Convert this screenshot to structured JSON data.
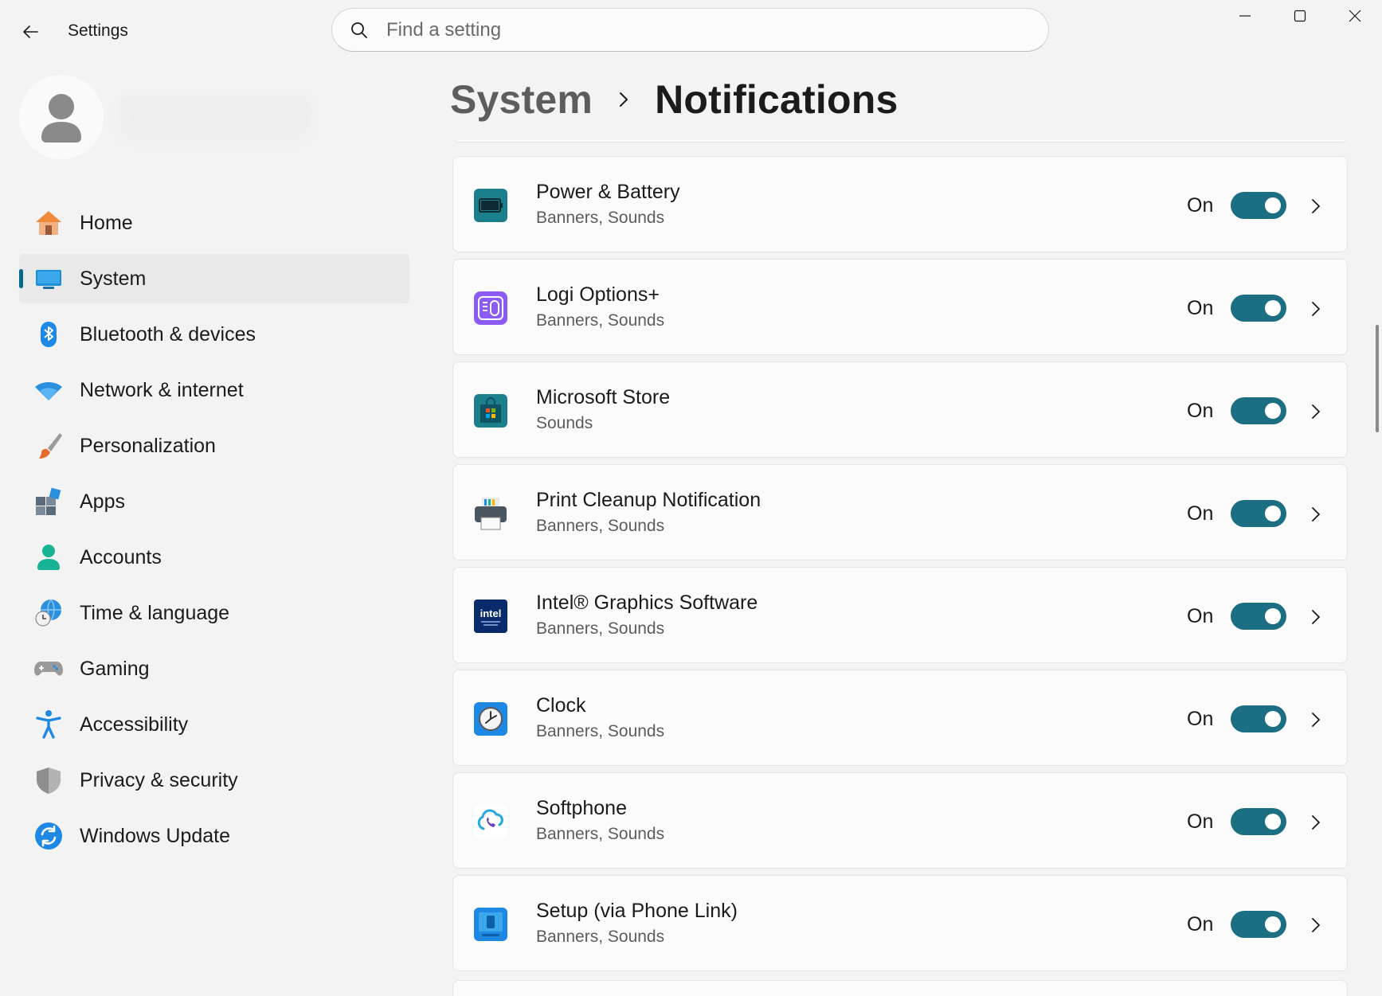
{
  "titlebar": {
    "app_title": "Settings",
    "search_placeholder": "Find a setting"
  },
  "sidebar": {
    "items": [
      {
        "label": "Home",
        "icon": "home-icon",
        "active": false
      },
      {
        "label": "System",
        "icon": "system-icon",
        "active": true
      },
      {
        "label": "Bluetooth & devices",
        "icon": "bluetooth-icon",
        "active": false
      },
      {
        "label": "Network & internet",
        "icon": "wifi-icon",
        "active": false
      },
      {
        "label": "Personalization",
        "icon": "brush-icon",
        "active": false
      },
      {
        "label": "Apps",
        "icon": "apps-icon",
        "active": false
      },
      {
        "label": "Accounts",
        "icon": "accounts-icon",
        "active": false
      },
      {
        "label": "Time & language",
        "icon": "globe-clock-icon",
        "active": false
      },
      {
        "label": "Gaming",
        "icon": "gamepad-icon",
        "active": false
      },
      {
        "label": "Accessibility",
        "icon": "accessibility-icon",
        "active": false
      },
      {
        "label": "Privacy & security",
        "icon": "shield-icon",
        "active": false
      },
      {
        "label": "Windows Update",
        "icon": "windows-update-icon",
        "active": false
      }
    ]
  },
  "breadcrumb": {
    "parent": "System",
    "current": "Notifications"
  },
  "notifications": [
    {
      "title": "Power & Battery",
      "subtitle": "Banners, Sounds",
      "state": "On",
      "enabled": true,
      "icon": "battery-icon"
    },
    {
      "title": "Logi Options+",
      "subtitle": "Banners, Sounds",
      "state": "On",
      "enabled": true,
      "icon": "logi-options-icon"
    },
    {
      "title": "Microsoft Store",
      "subtitle": "Sounds",
      "state": "On",
      "enabled": true,
      "icon": "store-icon"
    },
    {
      "title": "Print Cleanup Notification",
      "subtitle": "Banners, Sounds",
      "state": "On",
      "enabled": true,
      "icon": "printer-icon"
    },
    {
      "title": "Intel® Graphics Software",
      "subtitle": "Banners, Sounds",
      "state": "On",
      "enabled": true,
      "icon": "intel-icon",
      "icon_text": "intel"
    },
    {
      "title": "Clock",
      "subtitle": "Banners, Sounds",
      "state": "On",
      "enabled": true,
      "icon": "clock-icon"
    },
    {
      "title": "Softphone",
      "subtitle": "Banners, Sounds",
      "state": "On",
      "enabled": true,
      "icon": "softphone-icon"
    },
    {
      "title": "Setup (via Phone Link)",
      "subtitle": "Banners, Sounds",
      "state": "On",
      "enabled": true,
      "icon": "phone-link-icon"
    }
  ],
  "colors": {
    "accent": "#1c6e82",
    "background": "#f3f3f3",
    "card": "#fbfbfb"
  }
}
